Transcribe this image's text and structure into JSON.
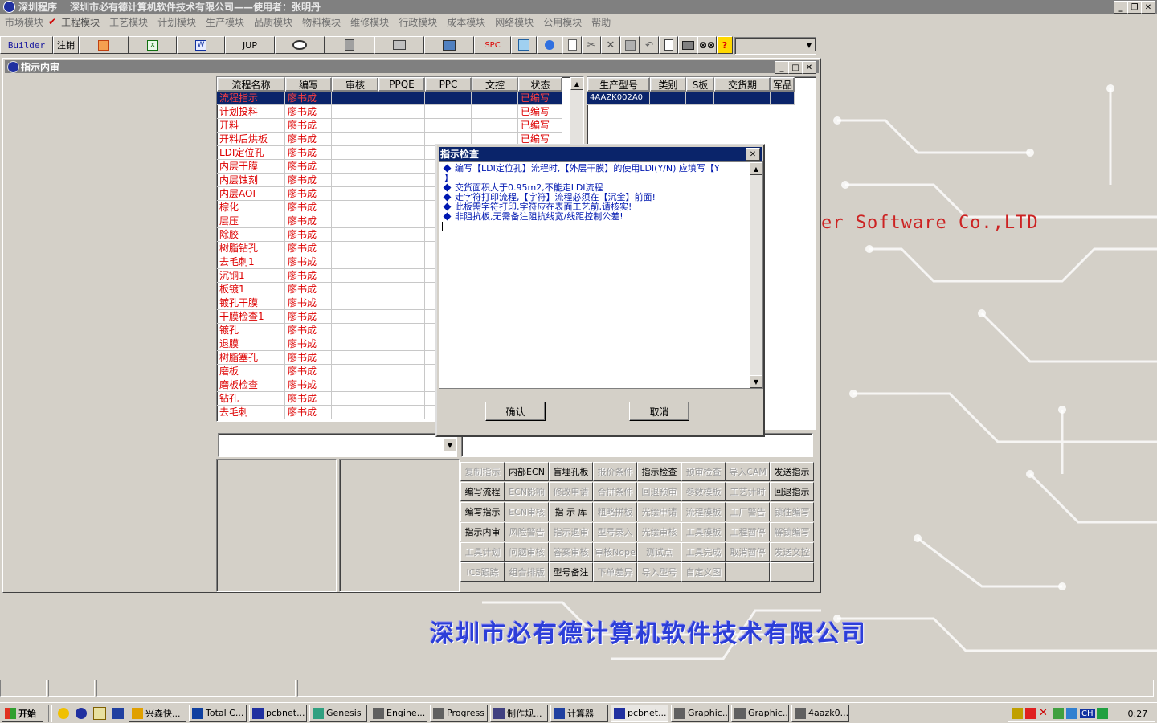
{
  "app": {
    "title_name": "深圳程序",
    "title_company": "深圳市必有德计算机软件技术有限公司——使用者：张明丹"
  },
  "menu": [
    "市场模块",
    "工程模块",
    "工艺模块",
    "计划模块",
    "生产模块",
    "品质模块",
    "物料模块",
    "维修模块",
    "行政模块",
    "成本模块",
    "网络模块",
    "公用模块",
    "帮助"
  ],
  "toolbar": {
    "builder": "Builder",
    "logout": "注销",
    "jup": "JUP",
    "spc": "SPC",
    "combo_value": ""
  },
  "background": {
    "brand_partial": "er Software Co.,LTD",
    "company_banner": "深圳市必有德计算机软件技术有限公司"
  },
  "main_window": {
    "title": "指示内审",
    "process_columns": [
      "流程名称",
      "编写",
      "审核",
      "PPQE",
      "PPC",
      "文控",
      "状态"
    ],
    "process_rows": [
      {
        "name": "流程指示",
        "writer": "廖书成",
        "status": "已编写"
      },
      {
        "name": "计划投料",
        "writer": "廖书成",
        "status": "已编写"
      },
      {
        "name": "开料",
        "writer": "廖书成",
        "status": "已编写"
      },
      {
        "name": "开料后烘板",
        "writer": "廖书成",
        "status": "已编写"
      },
      {
        "name": "LDI定位孔",
        "writer": "廖书成",
        "status": ""
      },
      {
        "name": "内层干膜",
        "writer": "廖书成",
        "status": ""
      },
      {
        "name": "内层蚀刻",
        "writer": "廖书成",
        "status": ""
      },
      {
        "name": "内层AOI",
        "writer": "廖书成",
        "status": ""
      },
      {
        "name": "棕化",
        "writer": "廖书成",
        "status": ""
      },
      {
        "name": "层压",
        "writer": "廖书成",
        "status": ""
      },
      {
        "name": "除胶",
        "writer": "廖书成",
        "status": ""
      },
      {
        "name": "树脂钻孔",
        "writer": "廖书成",
        "status": ""
      },
      {
        "name": "去毛刺1",
        "writer": "廖书成",
        "status": ""
      },
      {
        "name": "沉铜1",
        "writer": "廖书成",
        "status": ""
      },
      {
        "name": "板镀1",
        "writer": "廖书成",
        "status": ""
      },
      {
        "name": "镀孔干膜",
        "writer": "廖书成",
        "status": ""
      },
      {
        "name": "干膜检查1",
        "writer": "廖书成",
        "status": ""
      },
      {
        "name": "镀孔",
        "writer": "廖书成",
        "status": ""
      },
      {
        "name": "退膜",
        "writer": "廖书成",
        "status": ""
      },
      {
        "name": "树脂塞孔",
        "writer": "廖书成",
        "status": ""
      },
      {
        "name": "磨板",
        "writer": "廖书成",
        "status": ""
      },
      {
        "name": "磨板检查",
        "writer": "廖书成",
        "status": ""
      },
      {
        "name": "钻孔",
        "writer": "廖书成",
        "status": ""
      },
      {
        "name": "去毛刺",
        "writer": "廖书成",
        "status": ""
      }
    ],
    "model_columns": [
      "生产型号",
      "类别",
      "S板",
      "交货期",
      "军品"
    ],
    "model_rows": [
      {
        "model": "4AAZK002A0"
      }
    ],
    "buttons": [
      [
        {
          "label": "复制指示",
          "enabled": false
        },
        {
          "label": "内部ECN",
          "enabled": true
        },
        {
          "label": "盲埋孔板",
          "enabled": true
        },
        {
          "label": "报价条件",
          "enabled": false
        },
        {
          "label": "指示检查",
          "enabled": true
        },
        {
          "label": "预审检查",
          "enabled": false
        },
        {
          "label": "导入CAM",
          "enabled": false
        },
        {
          "label": "发送指示",
          "enabled": true
        }
      ],
      [
        {
          "label": "编写流程",
          "enabled": true
        },
        {
          "label": "ECN影响",
          "enabled": false
        },
        {
          "label": "修改申请",
          "enabled": false
        },
        {
          "label": "合拼条件",
          "enabled": false
        },
        {
          "label": "回退预审",
          "enabled": false
        },
        {
          "label": "参数模板",
          "enabled": false
        },
        {
          "label": "工艺计时",
          "enabled": false
        },
        {
          "label": "回退指示",
          "enabled": true
        }
      ],
      [
        {
          "label": "编写指示",
          "enabled": true
        },
        {
          "label": "ECN审核",
          "enabled": false
        },
        {
          "label": "指 示 库",
          "enabled": true
        },
        {
          "label": "粗略拼板",
          "enabled": false
        },
        {
          "label": "光绘申请",
          "enabled": false
        },
        {
          "label": "流程模板",
          "enabled": false
        },
        {
          "label": "工厂警告",
          "enabled": false
        },
        {
          "label": "锁住编写",
          "enabled": false
        }
      ],
      [
        {
          "label": "指示内审",
          "enabled": true
        },
        {
          "label": "风险警告",
          "enabled": false
        },
        {
          "label": "指示退审",
          "enabled": false
        },
        {
          "label": "型号录入",
          "enabled": false
        },
        {
          "label": "光绘审核",
          "enabled": false
        },
        {
          "label": "工具模板",
          "enabled": false
        },
        {
          "label": "工程暂停",
          "enabled": false
        },
        {
          "label": "解锁编写",
          "enabled": false
        }
      ],
      [
        {
          "label": "工具计划",
          "enabled": false
        },
        {
          "label": "问题审核",
          "enabled": false
        },
        {
          "label": "答案审核",
          "enabled": false
        },
        {
          "label": "审核Nope",
          "enabled": false
        },
        {
          "label": "测试点",
          "enabled": false
        },
        {
          "label": "工具完成",
          "enabled": false
        },
        {
          "label": "取消暂停",
          "enabled": false
        },
        {
          "label": "发送文控",
          "enabled": false
        }
      ],
      [
        {
          "label": "ICS跟踪",
          "enabled": false
        },
        {
          "label": "组合排版",
          "enabled": false
        },
        {
          "label": "型号备注",
          "enabled": true
        },
        {
          "label": "下单差异",
          "enabled": false
        },
        {
          "label": "导入型号",
          "enabled": false
        },
        {
          "label": "自定义图",
          "enabled": false
        },
        {
          "label": "",
          "enabled": false
        },
        {
          "label": "",
          "enabled": false
        }
      ]
    ]
  },
  "dialog": {
    "title": "指示检查",
    "messages": [
      "编写【LDI定位孔】流程时,【外层干膜】的使用LDI(Y/N) 应填写【Y",
      "】",
      "交货面积大于0.95m2,不能走LDI流程",
      "走字符打印流程,【字符】流程必须在【沉金】前面!",
      "此板需字符打印,字符应在表面工艺前,请核实!",
      "非阻抗板,无需备注阻抗线宽/线距控制公差!"
    ],
    "ok": "确认",
    "cancel": "取消"
  },
  "taskbar": {
    "start": "开始",
    "tasks": [
      {
        "label": "兴森快...",
        "active": false
      },
      {
        "label": "Total C...",
        "active": false
      },
      {
        "label": "pcbnet...",
        "active": false
      },
      {
        "label": "Genesis",
        "active": false
      },
      {
        "label": "Engine...",
        "active": false
      },
      {
        "label": "Progress",
        "active": false
      },
      {
        "label": "制作规...",
        "active": false
      },
      {
        "label": "计算器",
        "active": false
      },
      {
        "label": "pcbnet...",
        "active": true
      },
      {
        "label": "Graphic...",
        "active": false
      },
      {
        "label": "Graphic...",
        "active": false
      },
      {
        "label": "4aazk0...",
        "active": false
      }
    ],
    "lang": "CH",
    "clock": "0:27"
  }
}
